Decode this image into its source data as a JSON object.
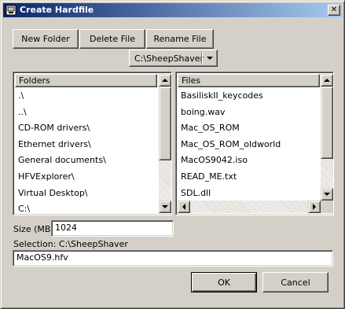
{
  "window": {
    "title": "Create Hardfile",
    "close_glyph": "✕"
  },
  "toolbar": {
    "new_folder": "New Folder",
    "delete_file": "Delete File",
    "rename_file": "Rename File"
  },
  "path_combo": {
    "value": "C:\\SheepShaver"
  },
  "folders": {
    "header": "Folders",
    "items": [
      ".\\",
      "..\\",
      "CD-ROM drivers\\",
      "Ethernet drivers\\",
      "General documents\\",
      "HFVExplorer\\",
      "Virtual Desktop\\",
      "C:\\"
    ]
  },
  "files": {
    "header": "Files",
    "items": [
      "BasiliskII_keycodes",
      "boing.wav",
      "Mac_OS_ROM",
      "Mac_OS_ROM_oldworld",
      "MacOS9042.iso",
      "READ_ME.txt",
      "SDL.dll"
    ]
  },
  "size": {
    "label": "Size (MB)",
    "value": "1024"
  },
  "selection": {
    "label": "Selection: C:\\SheepShaver",
    "value": "MacOS9.hfv"
  },
  "buttons": {
    "ok": "OK",
    "cancel": "Cancel"
  },
  "icons": {
    "app": "app-window-icon",
    "close": "close-icon"
  },
  "colors": {
    "titlebar_start": "#0a246a",
    "titlebar_end": "#a6caf0",
    "face": "#d4d0c8"
  }
}
